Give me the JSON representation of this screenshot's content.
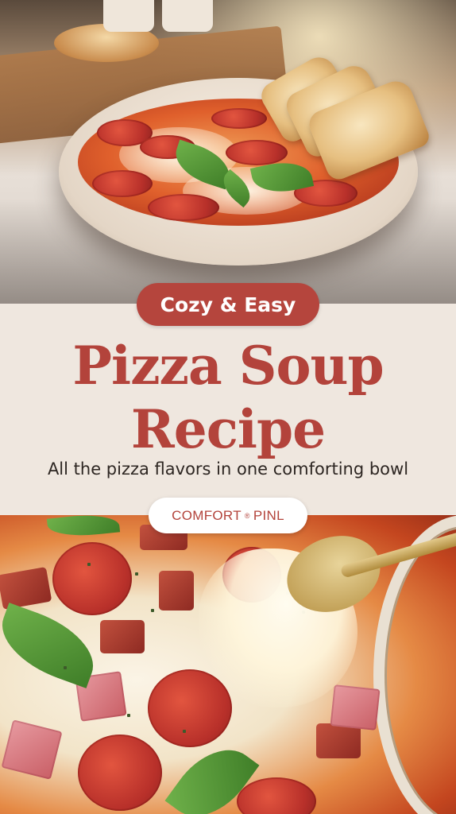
{
  "badge": {
    "label": "Cozy & Easy"
  },
  "title": {
    "line1": "Pizza Soup",
    "line2": "Recipe"
  },
  "subtitle": "All the pizza flavors in one comforting bowl",
  "brand": {
    "left": "COMFORT",
    "mark": "®",
    "right": "PINL"
  },
  "colors": {
    "accent": "#b5453d",
    "band_background": "#efe7df",
    "subtitle_text": "#2d2622"
  },
  "images": {
    "top": "bowl of pizza soup with pepperoni, mozzarella, basil and toasted bread",
    "bottom": "close-up of pizza soup with melted cheese pulled by a golden spoon"
  }
}
